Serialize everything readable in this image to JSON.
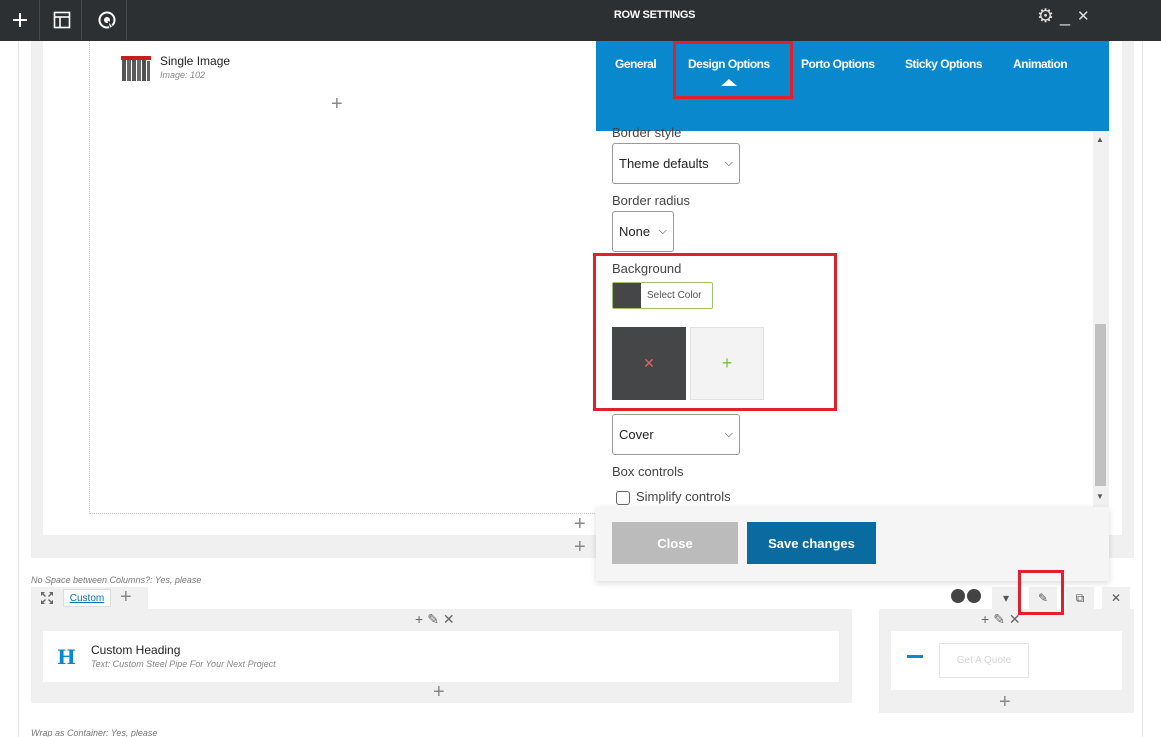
{
  "toolbar": {
    "title": "ROW SETTINGS",
    "buttons": [
      "add-element",
      "templates",
      "porto-studio"
    ]
  },
  "editor": {
    "single_image": {
      "title": "Single Image",
      "subtitle": "Image: 102"
    },
    "row2_note": "No Space between Columns?: Yes, please",
    "row2_layout_label": "Custom",
    "custom_heading": {
      "title": "Custom Heading",
      "subtitle": "Text: Custom Steel Pipe For Your Next Project",
      "icon_letter": "H"
    },
    "quote_button": "Get A Quote",
    "row3_note": "Wrap as Container: Yes, please"
  },
  "modal": {
    "tabs": [
      {
        "label": "General"
      },
      {
        "label": "Design Options",
        "active": true
      },
      {
        "label": "Porto Options"
      },
      {
        "label": "Sticky Options"
      },
      {
        "label": "Animation"
      }
    ],
    "fields": {
      "border_style_label": "Border style",
      "border_style_value": "Theme defaults",
      "border_radius_label": "Border radius",
      "border_radius_value": "None",
      "background_label": "Background",
      "select_color_label": "Select Color",
      "background_color": "#444647",
      "bg_size_value": "Cover",
      "box_controls_label": "Box controls",
      "simplify_controls_label": "Simplify controls",
      "simplify_controls_checked": false
    },
    "close_label": "Close",
    "save_label": "Save changes"
  },
  "colors": {
    "toolbar_bg": "#2d3033",
    "modal_header": "#0a88ce",
    "save_button": "#0a6ba0",
    "close_button": "#bbbbbb",
    "highlight": "#e0202a"
  }
}
